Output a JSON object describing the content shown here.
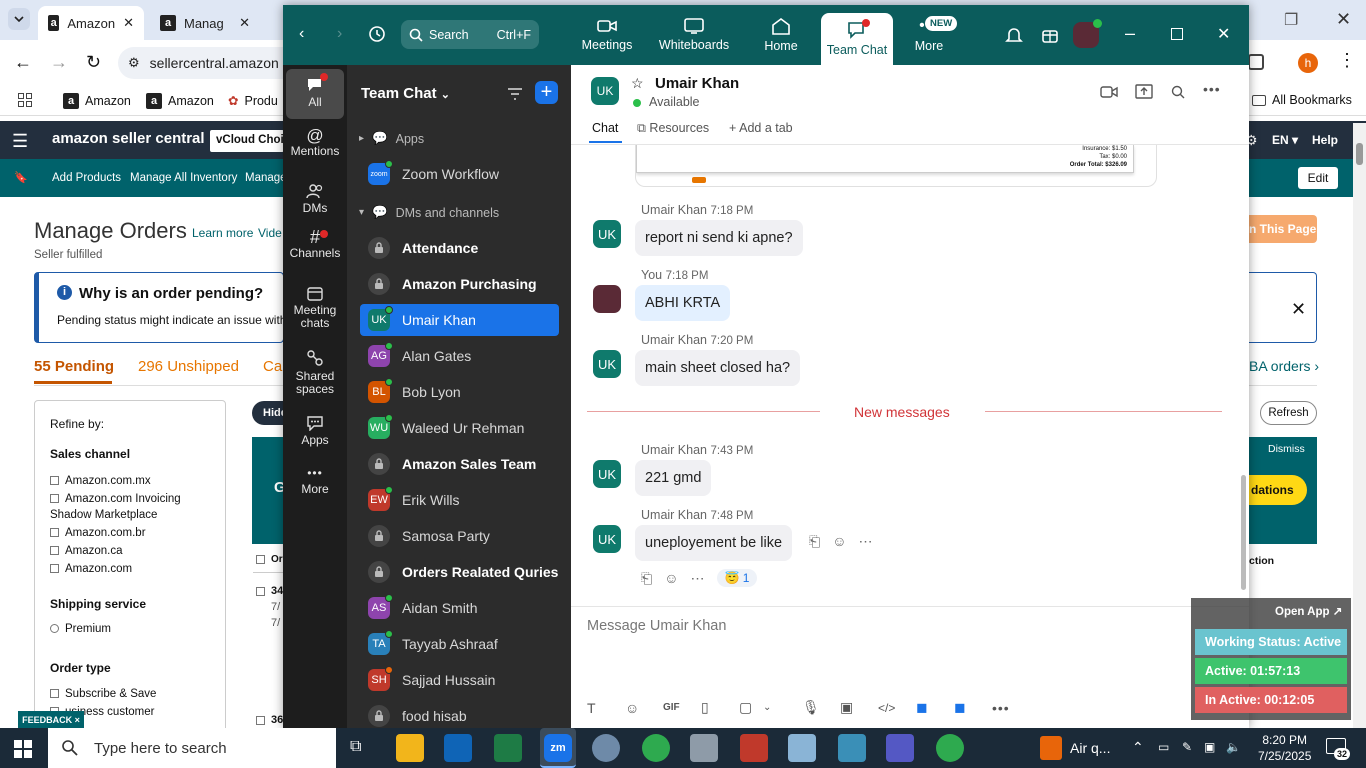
{
  "browser": {
    "tabs": [
      "Amazon",
      "Manag",
      ""
    ],
    "url": "sellercentral.amazon",
    "bookmarks": [
      "Amazon",
      "Amazon",
      "Produ"
    ],
    "all_bookmarks": "All Bookmarks",
    "profile_initial": "h"
  },
  "amazon": {
    "logo": "amazon seller central",
    "store": "vCloud Choic",
    "lang": "EN",
    "help": "Help",
    "sub_nav": [
      "Add Products",
      "Manage All Inventory",
      "Manage"
    ],
    "edit": "Edit",
    "page_title": "Manage Orders",
    "learn_more": "Learn more",
    "video": "Vide",
    "seller_fulfilled": "Seller fulfilled",
    "pending_title": "Why is an order pending?",
    "pending_text": "Pending status might indicate an issue with t",
    "this_page": "n This Page",
    "tabs": {
      "pending": "55 Pending",
      "unshipped": "296 Unshipped",
      "can": "Can",
      "fba": "BA orders ›"
    },
    "refresh": "Refresh",
    "hide": "Hide",
    "dismiss": "Dismiss",
    "recommend": "dations",
    "action": "ction",
    "shipping": "pping",
    "refine": "Refine by:",
    "sales_channel": "Sales channel",
    "channels": [
      "Amazon.com.mx",
      "Amazon.com Invoicing Shadow Marketplace",
      "Amazon.com.br",
      "Amazon.ca",
      "Amazon.com"
    ],
    "shipping_service": "Shipping service",
    "premium": "Premium",
    "order_type": "Order type",
    "order_types": [
      "Subscribe & Save",
      "usiness customer"
    ],
    "feedback": "FEEDBACK ×",
    "table_col": "Or",
    "row1": [
      "34",
      "7/",
      "7/"
    ],
    "row2": "36",
    "g_letter": "G"
  },
  "zoom": {
    "search": "Search",
    "search_shortcut": "Ctrl+F",
    "nav": [
      "Meetings",
      "Whiteboards",
      "Home",
      "Team Chat",
      "More"
    ],
    "new_badge": "NEW",
    "rail": [
      "All",
      "Mentions",
      "DMs",
      "Channels",
      "Meeting chats",
      "Shared spaces",
      "Apps",
      "More"
    ],
    "list_title": "Team Chat",
    "apps_header": "Apps",
    "zoom_workflow": "Zoom Workflow",
    "zoom_logo": "zoom",
    "dm_header": "DMs and channels",
    "items": [
      {
        "label": "Attendance",
        "type": "lock",
        "bold": true
      },
      {
        "label": "Amazon Purchasing",
        "type": "lock",
        "bold": true
      },
      {
        "label": "Umair Khan",
        "type": "av",
        "initials": "UK",
        "color": "#0f7a6c",
        "active": true
      },
      {
        "label": "Alan Gates",
        "type": "av",
        "initials": "AG",
        "color": "#8e44ad"
      },
      {
        "label": "Bob Lyon",
        "type": "av",
        "initials": "BL",
        "color": "#d35400"
      },
      {
        "label": "Waleed Ur Rehman",
        "type": "av",
        "initials": "WU",
        "color": "#27ae60"
      },
      {
        "label": "Amazon Sales Team",
        "type": "lock",
        "bold": true
      },
      {
        "label": "Erik Wills",
        "type": "av",
        "initials": "EW",
        "color": "#c0392b"
      },
      {
        "label": "Samosa Party",
        "type": "lock"
      },
      {
        "label": "Orders Realated Quries",
        "type": "lock",
        "bold": true
      },
      {
        "label": "Aidan Smith",
        "type": "av",
        "initials": "AS",
        "color": "#8e44ad"
      },
      {
        "label": "Tayyab Ashraaf",
        "type": "av",
        "initials": "TA",
        "color": "#2980b9"
      },
      {
        "label": "Sajjad Hussain",
        "type": "av",
        "initials": "SH",
        "color": "#c0392b"
      },
      {
        "label": "food hisab",
        "type": "lock"
      }
    ],
    "chat": {
      "name": "Umair Khan",
      "initials": "UK",
      "status": "Available",
      "tabs": [
        "Chat",
        "Resources",
        "Add a tab"
      ],
      "receipt": [
        "Insurance: $1.50",
        "Tax: $0.00",
        "Order Total: $326.09"
      ],
      "messages": [
        {
          "sender": "Umair Khan",
          "time": "7:18 PM",
          "text": "report ni send ki apne?"
        },
        {
          "sender": "You",
          "time": "7:18 PM",
          "text": "ABHI KRTA"
        },
        {
          "sender": "Umair Khan",
          "time": "7:20 PM",
          "text": "main sheet closed ha?"
        },
        {
          "sender": "Umair Khan",
          "time": "7:43 PM",
          "text": "221 gmd"
        },
        {
          "sender": "Umair Khan",
          "time": "7:48 PM",
          "text": "uneployement be like"
        }
      ],
      "new_messages": "New messages",
      "reaction_count": "1",
      "composer_placeholder": "Message Umair Khan",
      "gif": "GIF"
    }
  },
  "status_widget": {
    "open_app": "Open App ↗",
    "working": "Working Status: Active",
    "active": "Active: 01:57:13",
    "inactive": "In Active: 00:12:05"
  },
  "taskbar": {
    "search": "Type here to search",
    "weather": "Air q...",
    "time": "8:20 PM",
    "date": "7/25/2025",
    "notif": "32"
  }
}
